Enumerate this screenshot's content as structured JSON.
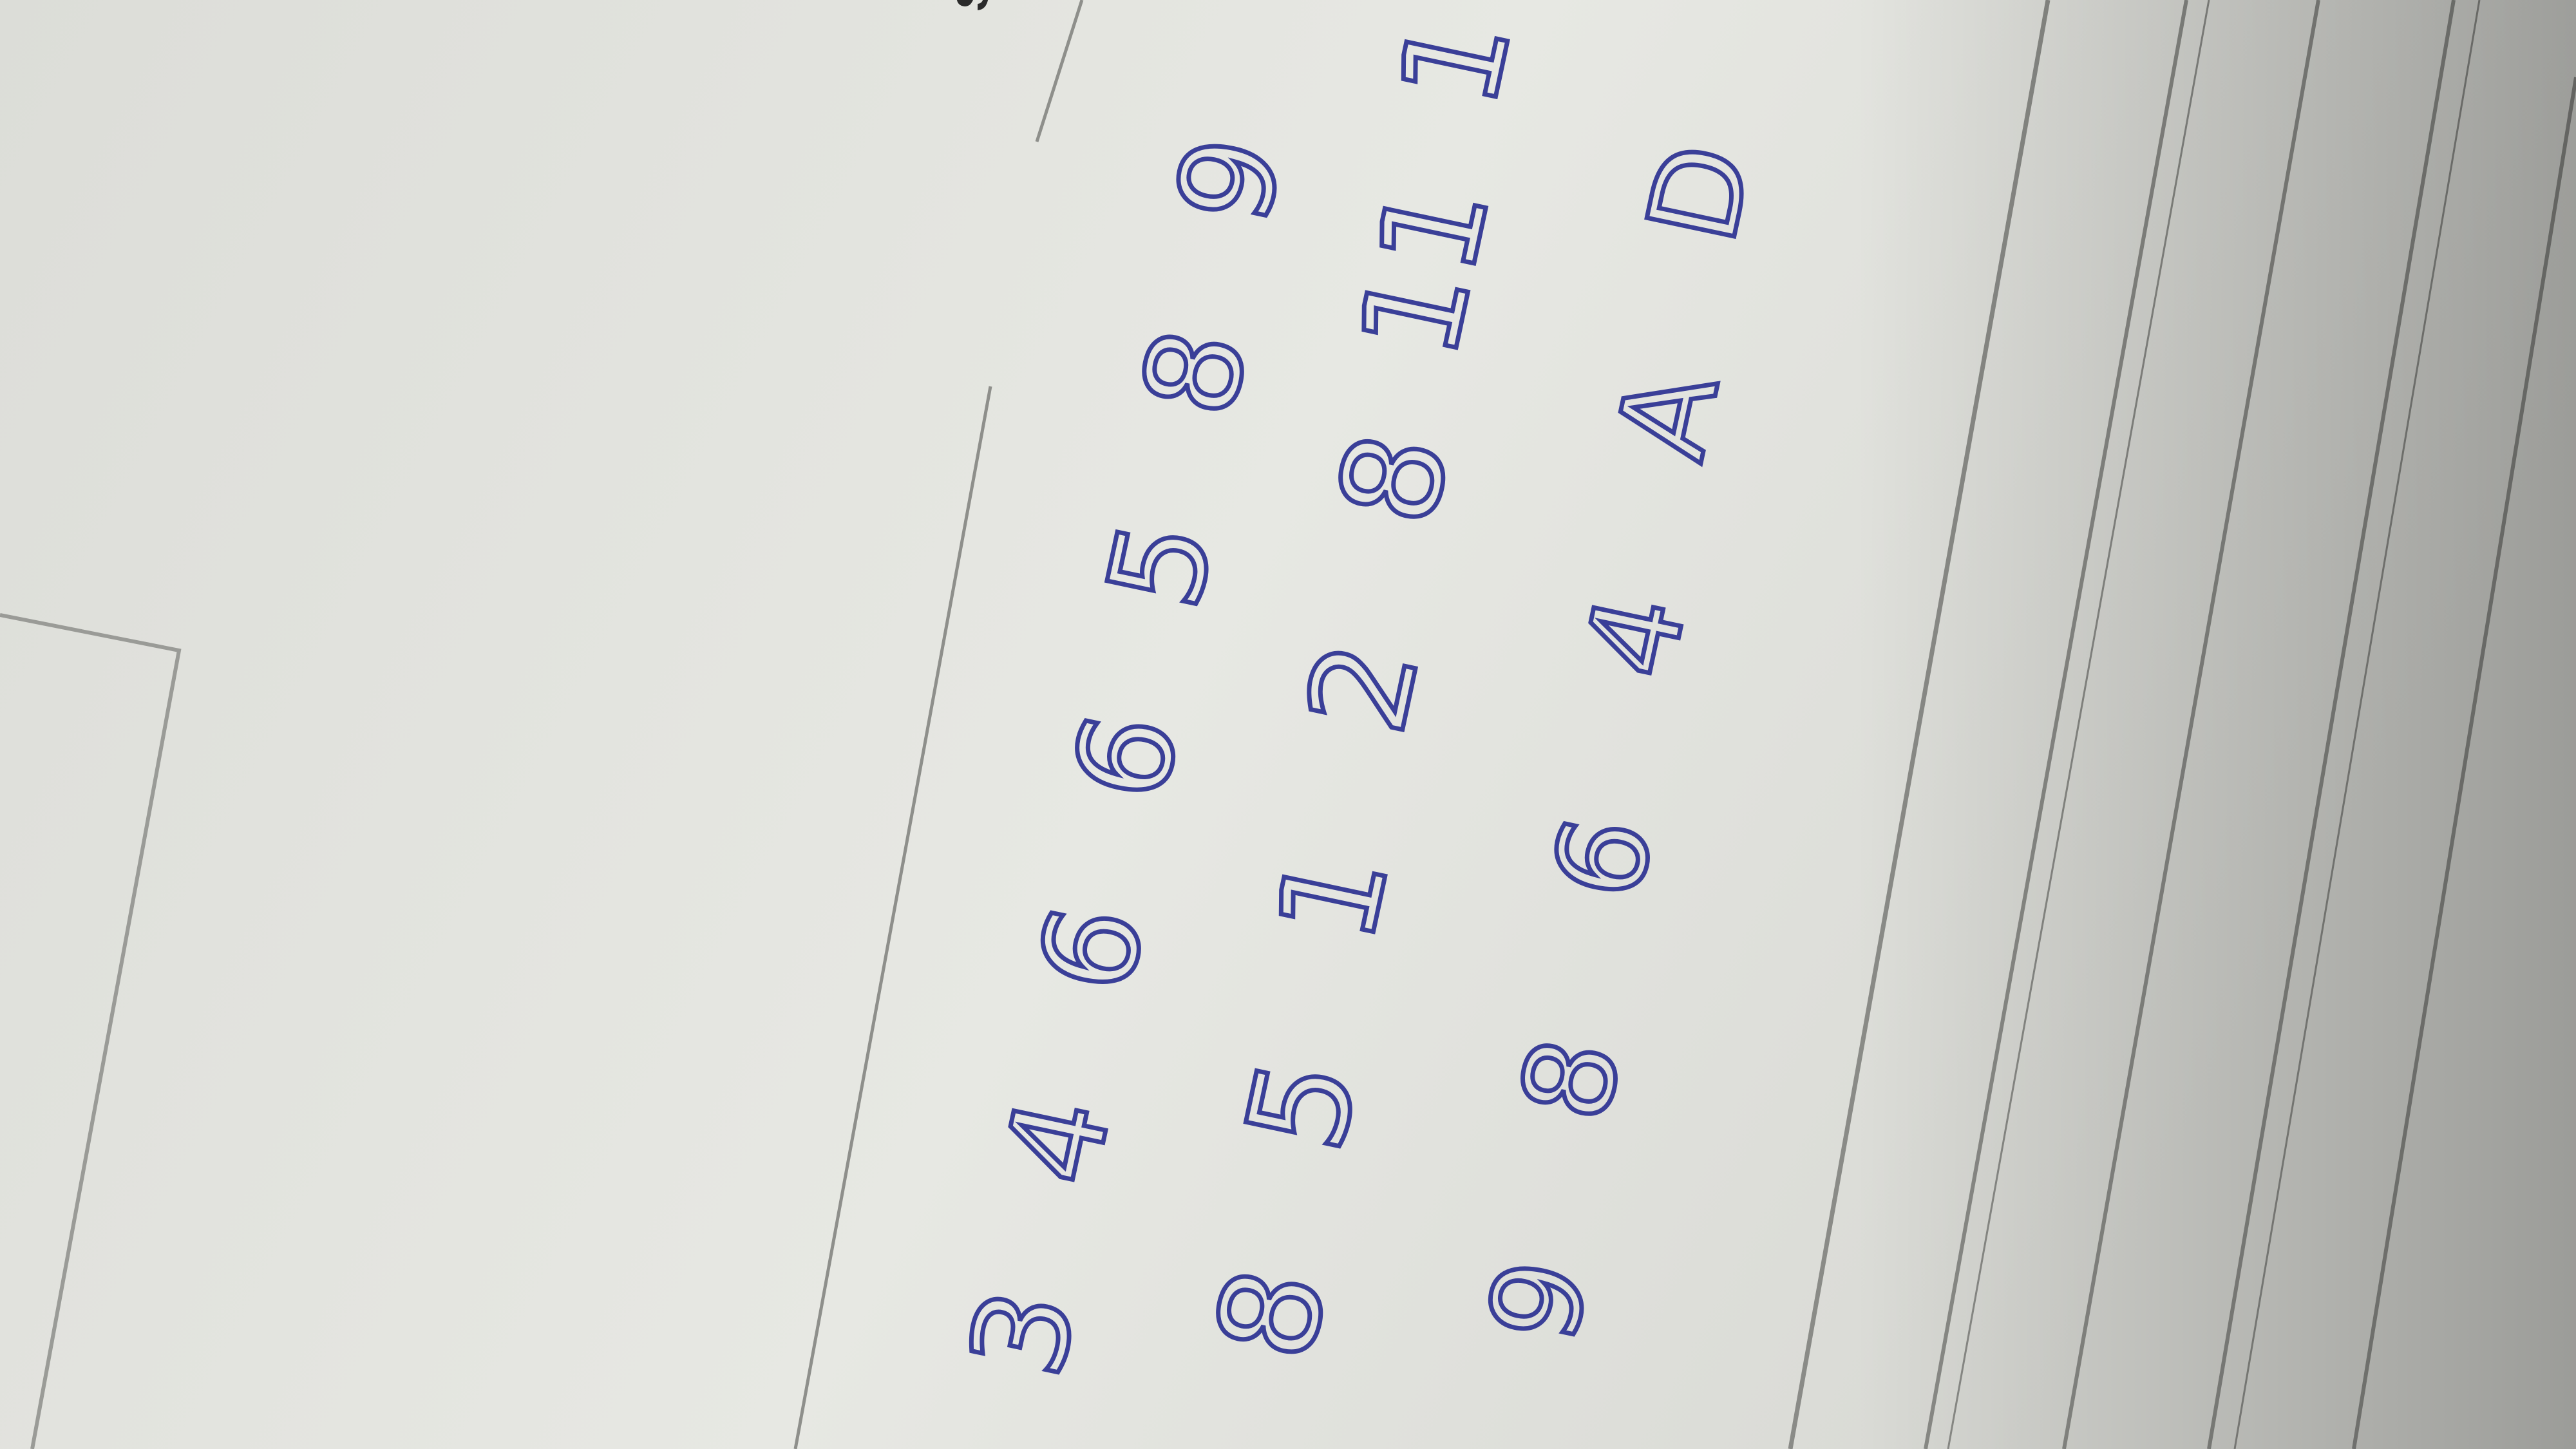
{
  "photo": {
    "paper_color": "#e6e7e2",
    "shadow_color": "#9fa09b",
    "ink_color": "#3a3f98",
    "rule_color": "#8a8b87",
    "corner_label": "SI",
    "rows": [
      {
        "name": "row-1",
        "glyphs": [
          "3",
          "4",
          "6",
          "6",
          "5",
          "8",
          "9"
        ]
      },
      {
        "name": "row-2",
        "glyphs": [
          "8",
          "5",
          "1",
          "2",
          "8",
          "11",
          "1"
        ]
      },
      {
        "name": "row-3",
        "glyphs": [
          "9",
          "8",
          "6",
          "4",
          "A",
          "D"
        ]
      }
    ]
  }
}
